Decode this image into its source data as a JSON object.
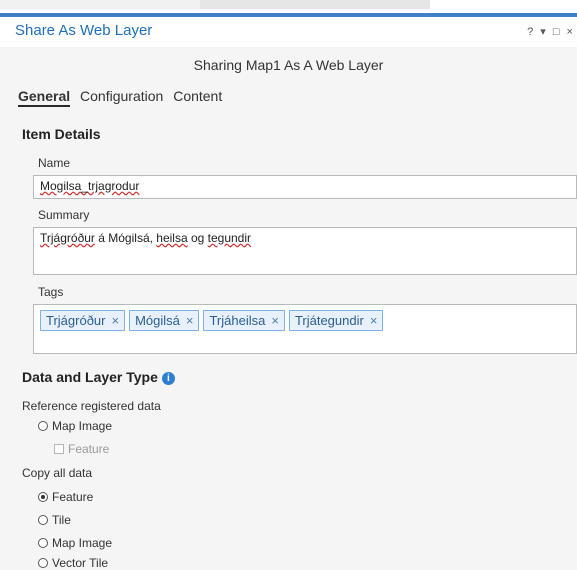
{
  "window": {
    "title": "Share As Web Layer",
    "controls": "? ▾ □ ×"
  },
  "subtitle": "Sharing Map1 As A Web Layer",
  "tabs": [
    {
      "label": "General",
      "active": true
    },
    {
      "label": "Configuration",
      "active": false
    },
    {
      "label": "Content",
      "active": false
    }
  ],
  "item_details": {
    "heading": "Item Details",
    "name_label": "Name",
    "name_value": "Mogilsa_trjagrodur",
    "summary_label": "Summary",
    "summary_parts": [
      "Trjágróður",
      " á Mógilsá, ",
      "heilsa",
      " og ",
      "tegundir"
    ],
    "tags_label": "Tags",
    "tags": [
      "Trjágróður",
      "Mógilsá",
      "Trjáheilsa",
      "Trjátegundir"
    ],
    "tag_remove_glyph": "×"
  },
  "data_layer_type": {
    "heading": "Data and Layer Type",
    "info_glyph": "i",
    "reference_label": "Reference registered data",
    "reference_options": [
      {
        "label": "Map Image",
        "type": "radio",
        "selected": false
      }
    ],
    "reference_suboption": {
      "label": "Feature",
      "type": "checkbox",
      "checked": false,
      "disabled": true
    },
    "copy_label": "Copy all data",
    "copy_options": [
      {
        "label": "Feature",
        "selected": true
      },
      {
        "label": "Tile",
        "selected": false
      },
      {
        "label": "Map Image",
        "selected": false
      },
      {
        "label": "Vector Tile",
        "selected": false
      }
    ]
  },
  "colors": {
    "accent": "#1e6fb9",
    "tag_border": "#7fb2e0",
    "tag_bg": "#e8f1fb",
    "info": "#2d7fd1"
  }
}
